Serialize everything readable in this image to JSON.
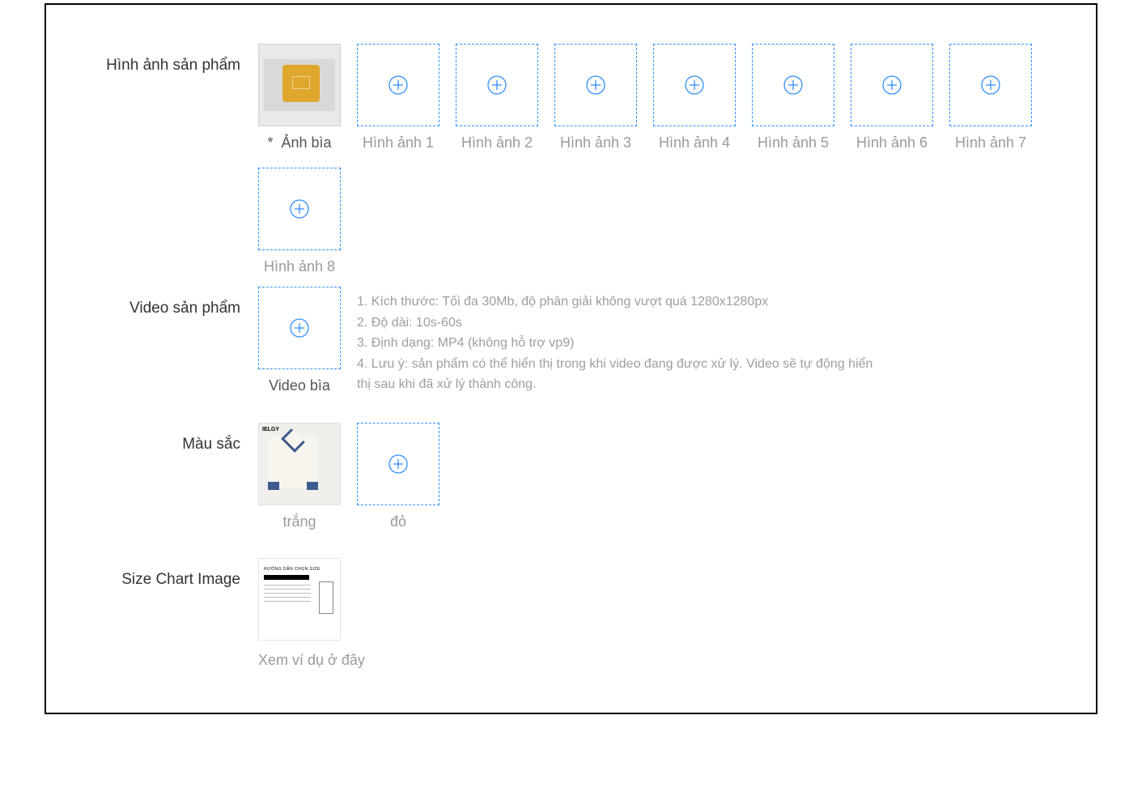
{
  "labels": {
    "product_images": "Hình ảnh sản phẩm",
    "product_video": "Video sản phẩm",
    "color": "Màu sắc",
    "size_chart": "Size Chart Image"
  },
  "images_row": {
    "cover_caption_prefix": "*",
    "cover_caption": "Ảnh bìa",
    "slots": [
      "Hình ảnh 1",
      "Hình ảnh 2",
      "Hình ảnh 3",
      "Hình ảnh 4",
      "Hình ảnh 5",
      "Hình ảnh 6",
      "Hình ảnh 7",
      "Hình ảnh 8"
    ]
  },
  "video": {
    "caption": "Video bìa",
    "notes": {
      "n1": "1. Kích thước: Tối đa 30Mb, độ phân giải không vượt quá 1280x1280px",
      "n2": "2. Độ dài: 10s-60s",
      "n3": "3. Định dạng: MP4 (không hỗ trợ vp9)",
      "n4": "4. Lưu ý: sản phẩm có thể hiển thị trong khi video đang được xử lý. Video sẽ tự động hiển thị sau khi đã xử lý thành công."
    }
  },
  "colors": {
    "items": [
      {
        "caption": "trắng",
        "filled": true
      },
      {
        "caption": "đỏ",
        "filled": false
      }
    ]
  },
  "size_chart": {
    "link_text": "Xem ví dụ ở đây"
  }
}
